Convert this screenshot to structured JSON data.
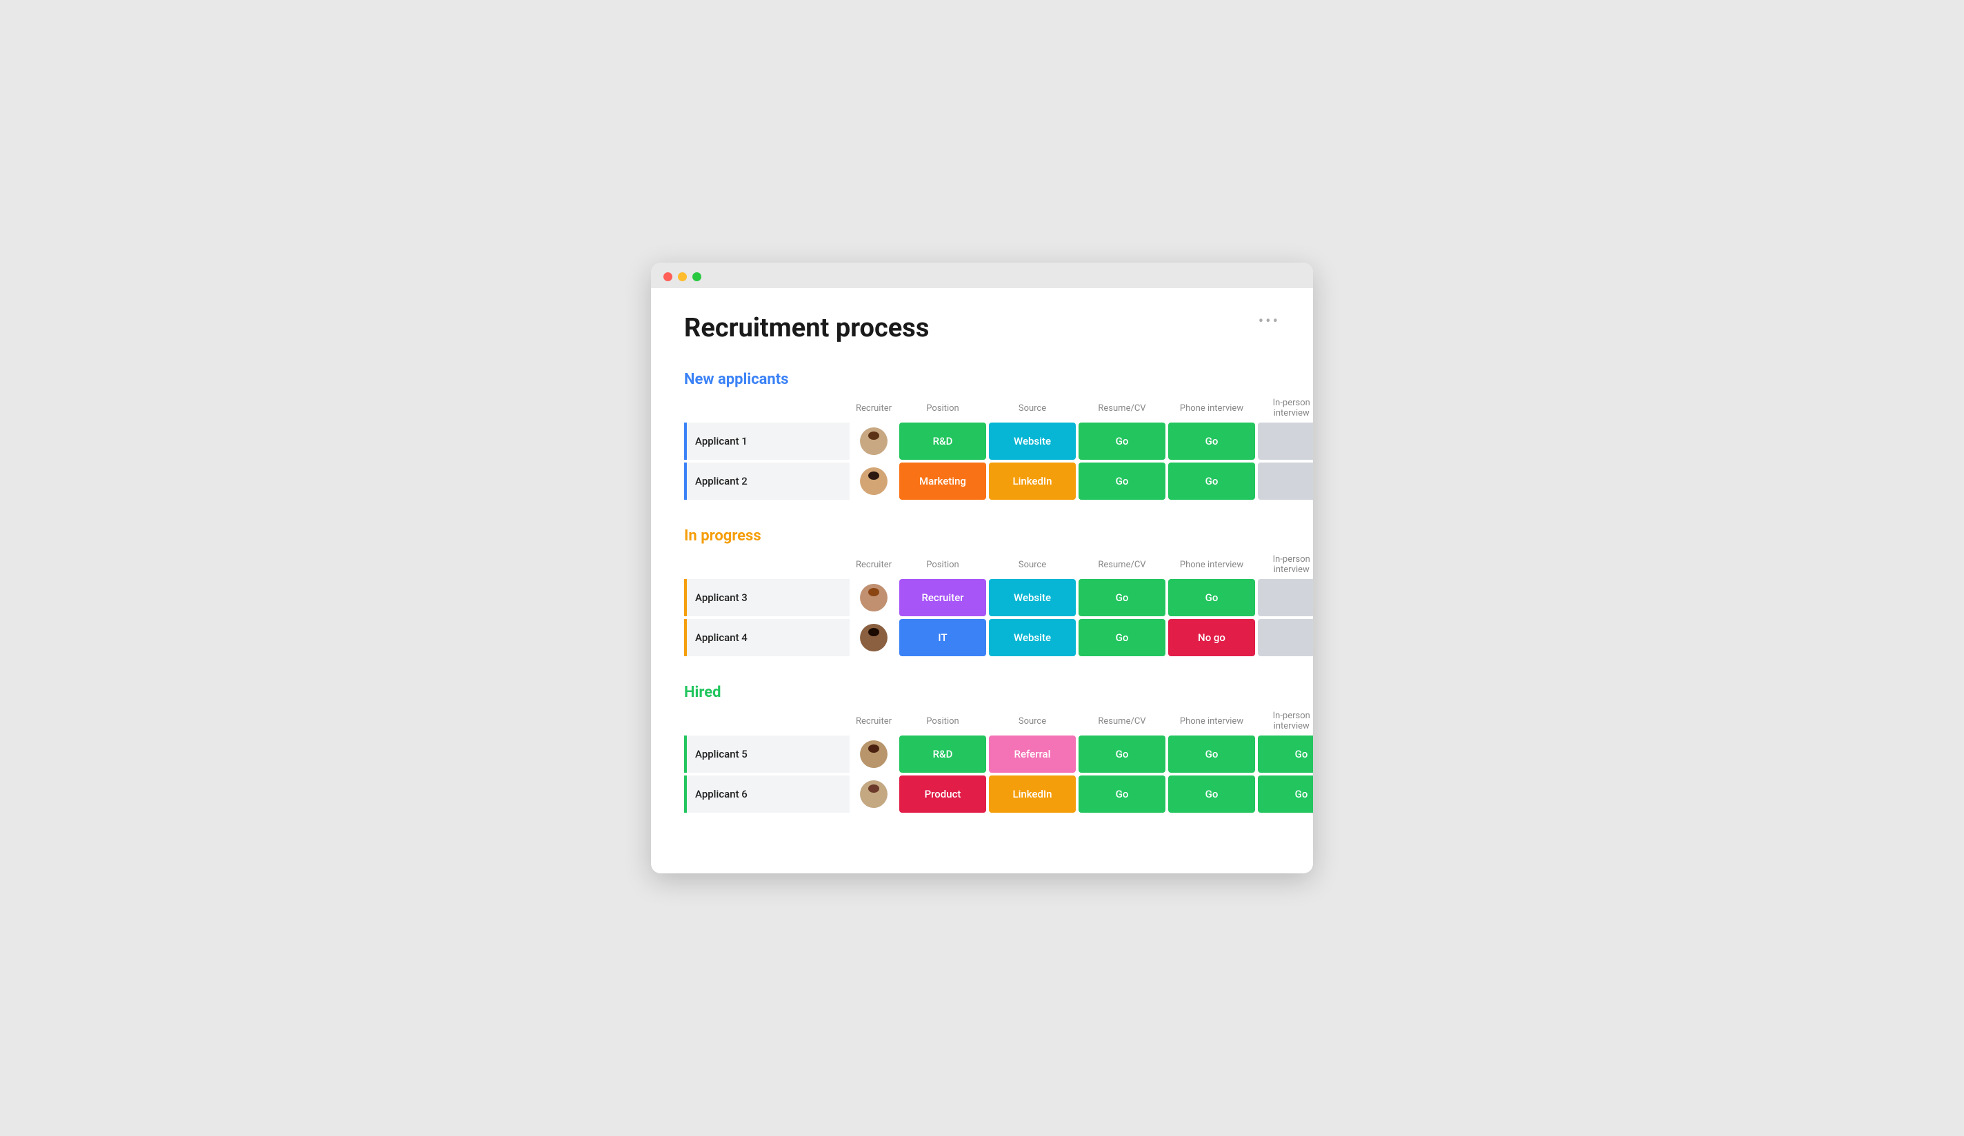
{
  "window": {
    "title": "Recruitment process"
  },
  "page": {
    "title": "Recruitment process",
    "more_icon": "•••"
  },
  "sections": [
    {
      "id": "new-applicants",
      "title": "New applicants",
      "title_color": "blue",
      "border_color": "blue-border",
      "columns": [
        "",
        "Recruiter",
        "Position",
        "Source",
        "Resume/CV",
        "Phone interview",
        "In-person interview"
      ],
      "rows": [
        {
          "name": "Applicant 1",
          "avatar_emoji": "👨",
          "position": {
            "label": "R&D",
            "color": "bg-green"
          },
          "source": {
            "label": "Website",
            "color": "bg-cyan"
          },
          "resume": {
            "label": "Go",
            "color": "bg-green"
          },
          "phone": {
            "label": "Go",
            "color": "bg-green"
          },
          "inperson": {
            "label": "",
            "color": "empty"
          }
        },
        {
          "name": "Applicant 2",
          "avatar_emoji": "👩",
          "position": {
            "label": "Marketing",
            "color": "bg-orange"
          },
          "source": {
            "label": "LinkedIn",
            "color": "bg-amber"
          },
          "resume": {
            "label": "Go",
            "color": "bg-green"
          },
          "phone": {
            "label": "Go",
            "color": "bg-green"
          },
          "inperson": {
            "label": "",
            "color": "empty"
          }
        }
      ]
    },
    {
      "id": "in-progress",
      "title": "In progress",
      "title_color": "orange",
      "border_color": "orange-border",
      "columns": [
        "",
        "Recruiter",
        "Position",
        "Source",
        "Resume/CV",
        "Phone interview",
        "In-person interview"
      ],
      "rows": [
        {
          "name": "Applicant 3",
          "avatar_emoji": "👩‍🦱",
          "position": {
            "label": "Recruiter",
            "color": "bg-purple"
          },
          "source": {
            "label": "Website",
            "color": "bg-cyan"
          },
          "resume": {
            "label": "Go",
            "color": "bg-green"
          },
          "phone": {
            "label": "Go",
            "color": "bg-green"
          },
          "inperson": {
            "label": "",
            "color": "empty"
          }
        },
        {
          "name": "Applicant 4",
          "avatar_emoji": "👨‍🦱",
          "position": {
            "label": "IT",
            "color": "bg-blue-dark"
          },
          "source": {
            "label": "Website",
            "color": "bg-cyan"
          },
          "resume": {
            "label": "Go",
            "color": "bg-green"
          },
          "phone": {
            "label": "No go",
            "color": "bg-red"
          },
          "inperson": {
            "label": "",
            "color": "empty"
          }
        }
      ]
    },
    {
      "id": "hired",
      "title": "Hired",
      "title_color": "green",
      "border_color": "green-border",
      "columns": [
        "",
        "Recruiter",
        "Position",
        "Source",
        "Resume/CV",
        "Phone interview",
        "In-person interview"
      ],
      "rows": [
        {
          "name": "Applicant 5",
          "avatar_emoji": "👨",
          "position": {
            "label": "R&D",
            "color": "bg-green"
          },
          "source": {
            "label": "Referral",
            "color": "bg-pink"
          },
          "resume": {
            "label": "Go",
            "color": "bg-green"
          },
          "phone": {
            "label": "Go",
            "color": "bg-green"
          },
          "inperson": {
            "label": "Go",
            "color": "bg-green"
          }
        },
        {
          "name": "Applicant 6",
          "avatar_emoji": "👩",
          "position": {
            "label": "Product",
            "color": "bg-red"
          },
          "source": {
            "label": "LinkedIn",
            "color": "bg-amber"
          },
          "resume": {
            "label": "Go",
            "color": "bg-green"
          },
          "phone": {
            "label": "Go",
            "color": "bg-green"
          },
          "inperson": {
            "label": "Go",
            "color": "bg-green"
          }
        }
      ]
    }
  ]
}
